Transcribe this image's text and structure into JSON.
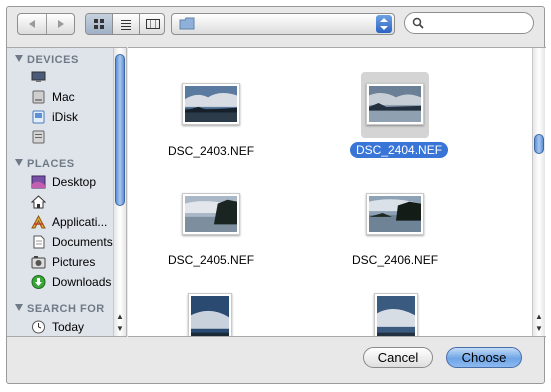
{
  "toolbar": {
    "back_icon": "back-arrow-icon",
    "forward_icon": "forward-arrow-icon",
    "view_icons": [
      "icon-view-icon",
      "list-view-icon",
      "column-view-icon"
    ],
    "location_icon": "folder-icon",
    "search_placeholder": ""
  },
  "sidebar": {
    "sections": [
      {
        "title": "DEVICES",
        "items": [
          {
            "label": "",
            "icon": "computer-icon"
          },
          {
            "label": "Mac",
            "icon": "hard-drive-icon"
          },
          {
            "label": "iDisk",
            "icon": "idisk-icon"
          },
          {
            "label": "",
            "icon": "drive-icon"
          }
        ]
      },
      {
        "title": "PLACES",
        "items": [
          {
            "label": "Desktop",
            "icon": "desktop-icon"
          },
          {
            "label": "",
            "icon": "home-icon"
          },
          {
            "label": "Applicati...",
            "icon": "applications-icon"
          },
          {
            "label": "Documents",
            "icon": "documents-icon"
          },
          {
            "label": "Pictures",
            "icon": "pictures-icon"
          },
          {
            "label": "Downloads",
            "icon": "downloads-icon"
          }
        ]
      },
      {
        "title": "SEARCH FOR",
        "items": [
          {
            "label": "Today",
            "icon": "clock-icon"
          }
        ]
      }
    ]
  },
  "files": [
    {
      "name": "DSC_2403.NEF",
      "selected": false
    },
    {
      "name": "DSC_2404.NEF",
      "selected": true
    },
    {
      "name": "DSC_2405.NEF",
      "selected": false
    },
    {
      "name": "DSC_2406.NEF",
      "selected": false
    },
    {
      "name": "",
      "selected": false
    },
    {
      "name": "",
      "selected": false
    }
  ],
  "buttons": {
    "cancel": "Cancel",
    "choose": "Choose"
  },
  "colors": {
    "selection": "#3875d7",
    "sidebar_bg": "#dfe4ea",
    "section_header": "#6f7a86"
  }
}
